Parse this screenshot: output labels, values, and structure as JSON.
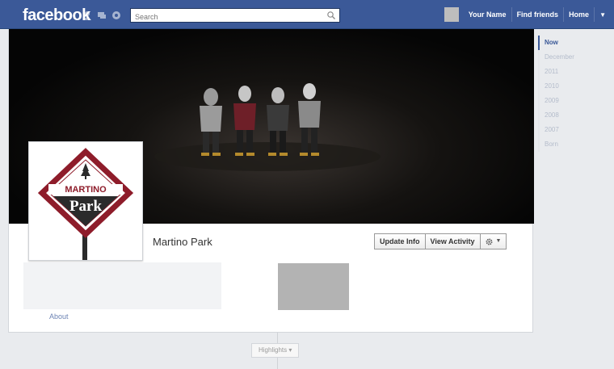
{
  "topbar": {
    "logo": "facebook",
    "search_placeholder": "Search",
    "user_name": "Your Name",
    "find_friends": "Find friends",
    "home": "Home"
  },
  "profile": {
    "name": "Martino Park",
    "logo_text_top": "MARTINO",
    "logo_text_bottom": "Park"
  },
  "actions": {
    "update_info": "Update Info",
    "view_activity": "View Activity"
  },
  "about": {
    "label": "About"
  },
  "highlights": {
    "label": "Highlights ▾"
  },
  "scrubber": {
    "items": [
      "Now",
      "December",
      "2011",
      "2010",
      "2009",
      "2008",
      "2007",
      "Born"
    ]
  },
  "colors": {
    "brand": "#3b5998",
    "logo_red": "#8e1c2a",
    "logo_dark": "#2b2b2b"
  }
}
